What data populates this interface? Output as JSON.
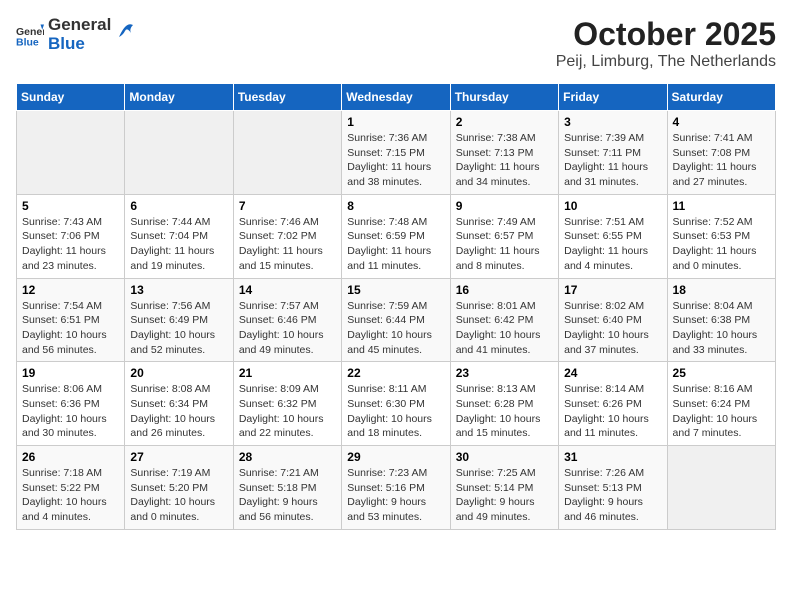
{
  "header": {
    "logo_general": "General",
    "logo_blue": "Blue",
    "title": "October 2025",
    "subtitle": "Peij, Limburg, The Netherlands"
  },
  "weekdays": [
    "Sunday",
    "Monday",
    "Tuesday",
    "Wednesday",
    "Thursday",
    "Friday",
    "Saturday"
  ],
  "weeks": [
    [
      {
        "day": "",
        "info": ""
      },
      {
        "day": "",
        "info": ""
      },
      {
        "day": "",
        "info": ""
      },
      {
        "day": "1",
        "info": "Sunrise: 7:36 AM\nSunset: 7:15 PM\nDaylight: 11 hours\nand 38 minutes."
      },
      {
        "day": "2",
        "info": "Sunrise: 7:38 AM\nSunset: 7:13 PM\nDaylight: 11 hours\nand 34 minutes."
      },
      {
        "day": "3",
        "info": "Sunrise: 7:39 AM\nSunset: 7:11 PM\nDaylight: 11 hours\nand 31 minutes."
      },
      {
        "day": "4",
        "info": "Sunrise: 7:41 AM\nSunset: 7:08 PM\nDaylight: 11 hours\nand 27 minutes."
      }
    ],
    [
      {
        "day": "5",
        "info": "Sunrise: 7:43 AM\nSunset: 7:06 PM\nDaylight: 11 hours\nand 23 minutes."
      },
      {
        "day": "6",
        "info": "Sunrise: 7:44 AM\nSunset: 7:04 PM\nDaylight: 11 hours\nand 19 minutes."
      },
      {
        "day": "7",
        "info": "Sunrise: 7:46 AM\nSunset: 7:02 PM\nDaylight: 11 hours\nand 15 minutes."
      },
      {
        "day": "8",
        "info": "Sunrise: 7:48 AM\nSunset: 6:59 PM\nDaylight: 11 hours\nand 11 minutes."
      },
      {
        "day": "9",
        "info": "Sunrise: 7:49 AM\nSunset: 6:57 PM\nDaylight: 11 hours\nand 8 minutes."
      },
      {
        "day": "10",
        "info": "Sunrise: 7:51 AM\nSunset: 6:55 PM\nDaylight: 11 hours\nand 4 minutes."
      },
      {
        "day": "11",
        "info": "Sunrise: 7:52 AM\nSunset: 6:53 PM\nDaylight: 11 hours\nand 0 minutes."
      }
    ],
    [
      {
        "day": "12",
        "info": "Sunrise: 7:54 AM\nSunset: 6:51 PM\nDaylight: 10 hours\nand 56 minutes."
      },
      {
        "day": "13",
        "info": "Sunrise: 7:56 AM\nSunset: 6:49 PM\nDaylight: 10 hours\nand 52 minutes."
      },
      {
        "day": "14",
        "info": "Sunrise: 7:57 AM\nSunset: 6:46 PM\nDaylight: 10 hours\nand 49 minutes."
      },
      {
        "day": "15",
        "info": "Sunrise: 7:59 AM\nSunset: 6:44 PM\nDaylight: 10 hours\nand 45 minutes."
      },
      {
        "day": "16",
        "info": "Sunrise: 8:01 AM\nSunset: 6:42 PM\nDaylight: 10 hours\nand 41 minutes."
      },
      {
        "day": "17",
        "info": "Sunrise: 8:02 AM\nSunset: 6:40 PM\nDaylight: 10 hours\nand 37 minutes."
      },
      {
        "day": "18",
        "info": "Sunrise: 8:04 AM\nSunset: 6:38 PM\nDaylight: 10 hours\nand 33 minutes."
      }
    ],
    [
      {
        "day": "19",
        "info": "Sunrise: 8:06 AM\nSunset: 6:36 PM\nDaylight: 10 hours\nand 30 minutes."
      },
      {
        "day": "20",
        "info": "Sunrise: 8:08 AM\nSunset: 6:34 PM\nDaylight: 10 hours\nand 26 minutes."
      },
      {
        "day": "21",
        "info": "Sunrise: 8:09 AM\nSunset: 6:32 PM\nDaylight: 10 hours\nand 22 minutes."
      },
      {
        "day": "22",
        "info": "Sunrise: 8:11 AM\nSunset: 6:30 PM\nDaylight: 10 hours\nand 18 minutes."
      },
      {
        "day": "23",
        "info": "Sunrise: 8:13 AM\nSunset: 6:28 PM\nDaylight: 10 hours\nand 15 minutes."
      },
      {
        "day": "24",
        "info": "Sunrise: 8:14 AM\nSunset: 6:26 PM\nDaylight: 10 hours\nand 11 minutes."
      },
      {
        "day": "25",
        "info": "Sunrise: 8:16 AM\nSunset: 6:24 PM\nDaylight: 10 hours\nand 7 minutes."
      }
    ],
    [
      {
        "day": "26",
        "info": "Sunrise: 7:18 AM\nSunset: 5:22 PM\nDaylight: 10 hours\nand 4 minutes."
      },
      {
        "day": "27",
        "info": "Sunrise: 7:19 AM\nSunset: 5:20 PM\nDaylight: 10 hours\nand 0 minutes."
      },
      {
        "day": "28",
        "info": "Sunrise: 7:21 AM\nSunset: 5:18 PM\nDaylight: 9 hours\nand 56 minutes."
      },
      {
        "day": "29",
        "info": "Sunrise: 7:23 AM\nSunset: 5:16 PM\nDaylight: 9 hours\nand 53 minutes."
      },
      {
        "day": "30",
        "info": "Sunrise: 7:25 AM\nSunset: 5:14 PM\nDaylight: 9 hours\nand 49 minutes."
      },
      {
        "day": "31",
        "info": "Sunrise: 7:26 AM\nSunset: 5:13 PM\nDaylight: 9 hours\nand 46 minutes."
      },
      {
        "day": "",
        "info": ""
      }
    ]
  ]
}
